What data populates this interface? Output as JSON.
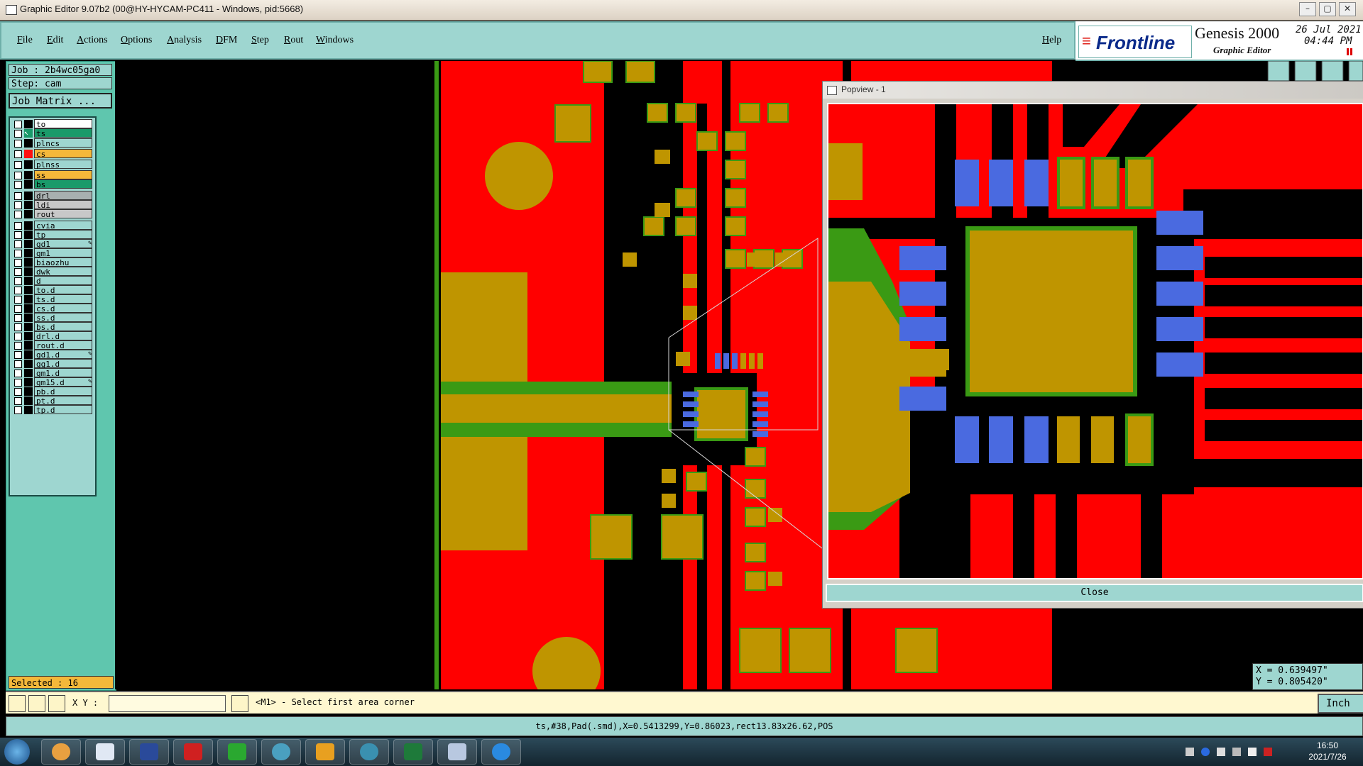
{
  "window": {
    "title": "Graphic Editor 9.07b2 (00@HY-HYCAM-PC411 - Windows, pid:5668)"
  },
  "menu": [
    "File",
    "Edit",
    "Actions",
    "Options",
    "Analysis",
    "DFM",
    "Step",
    "Rout",
    "Windows"
  ],
  "help_label": "Help",
  "brand": {
    "logo": "Frontline",
    "product": "Genesis 2000",
    "subtitle": "Graphic Editor",
    "date": "26 Jul 2021",
    "time": "04:44 PM"
  },
  "job": {
    "job_label": "Job : 2b4wc05ga0",
    "step_label": "Step: cam",
    "matrix_button": "Job Matrix ..."
  },
  "layers": [
    {
      "name": "to",
      "color": "#ffffff",
      "swatch": "#000000"
    },
    {
      "name": "ts",
      "color": "#1a9a6a",
      "swatch": "#000000",
      "work": true
    },
    {
      "name": "plncs",
      "color": "#9ed6d0",
      "swatch": "#000000"
    },
    {
      "name": "cs",
      "color": "#f4b83a",
      "swatch": "#ff1010"
    },
    {
      "name": "plnss",
      "color": "#9ed6d0",
      "swatch": "#000000"
    },
    {
      "name": "ss",
      "color": "#f4b83a",
      "swatch": "#000000"
    },
    {
      "name": "bs",
      "color": "#1a9a6a",
      "swatch": "#000000"
    },
    {
      "name": "drl",
      "color": "#a8b0b0",
      "swatch": "#000000"
    },
    {
      "name": "ldi",
      "color": "#c8c8c8",
      "swatch": "#000000"
    },
    {
      "name": "rout",
      "color": "#c8c8c8",
      "swatch": "#000000"
    },
    {
      "name": "cvia",
      "color": "#9ed6d0",
      "swatch": "#000000"
    },
    {
      "name": "tp",
      "color": "#9ed6d0",
      "swatch": "#000000"
    },
    {
      "name": "gd1",
      "color": "#9ed6d0",
      "swatch": "#000000",
      "mark": "✎"
    },
    {
      "name": "gm1",
      "color": "#9ed6d0",
      "swatch": "#000000"
    },
    {
      "name": "biaozhu",
      "color": "#9ed6d0",
      "swatch": "#000000"
    },
    {
      "name": "dwk",
      "color": "#9ed6d0",
      "swatch": "#000000"
    },
    {
      "name": "d",
      "color": "#9ed6d0",
      "swatch": "#000000"
    },
    {
      "name": "to.d",
      "color": "#9ed6d0",
      "swatch": "#000000"
    },
    {
      "name": "ts.d",
      "color": "#9ed6d0",
      "swatch": "#000000"
    },
    {
      "name": "cs.d",
      "color": "#9ed6d0",
      "swatch": "#000000"
    },
    {
      "name": "ss.d",
      "color": "#9ed6d0",
      "swatch": "#000000"
    },
    {
      "name": "bs.d",
      "color": "#9ed6d0",
      "swatch": "#000000"
    },
    {
      "name": "drl.d",
      "color": "#9ed6d0",
      "swatch": "#000000"
    },
    {
      "name": "rout.d",
      "color": "#9ed6d0",
      "swatch": "#000000"
    },
    {
      "name": "gd1.d",
      "color": "#9ed6d0",
      "swatch": "#000000",
      "mark": "✎"
    },
    {
      "name": "gg1.d",
      "color": "#9ed6d0",
      "swatch": "#000000"
    },
    {
      "name": "gm1.d",
      "color": "#9ed6d0",
      "swatch": "#000000"
    },
    {
      "name": "gm15.d",
      "color": "#9ed6d0",
      "swatch": "#000000",
      "mark": "✎"
    },
    {
      "name": "pb.d",
      "color": "#9ed6d0",
      "swatch": "#000000"
    },
    {
      "name": "pt.d",
      "color": "#9ed6d0",
      "swatch": "#000000"
    },
    {
      "name": "tp.d",
      "color": "#9ed6d0",
      "swatch": "#000000"
    }
  ],
  "selected_label": "Selected : 16",
  "popview": {
    "title": "Popview - 1",
    "close": "Close"
  },
  "coords": {
    "x": "X = 0.639497\"",
    "y": "Y = 0.805420\""
  },
  "command": {
    "xy_label": "X Y :",
    "xy_value": "",
    "prompt": "<M1> - Select first area corner",
    "units": "Inch"
  },
  "status_text": "ts,#38,Pad(.smd),X=0.5413299,Y=0.86023,rect13.83x26.62,POS",
  "clock": {
    "time": "16:50",
    "date": "2021/7/26"
  },
  "colors": {
    "copper": "#ff0000",
    "pad": "#bf9500",
    "smd_selected": "#4a6ae0",
    "mask": "#3a9a14",
    "panel": "#5fc6ae",
    "menu": "#9ed6d0"
  }
}
